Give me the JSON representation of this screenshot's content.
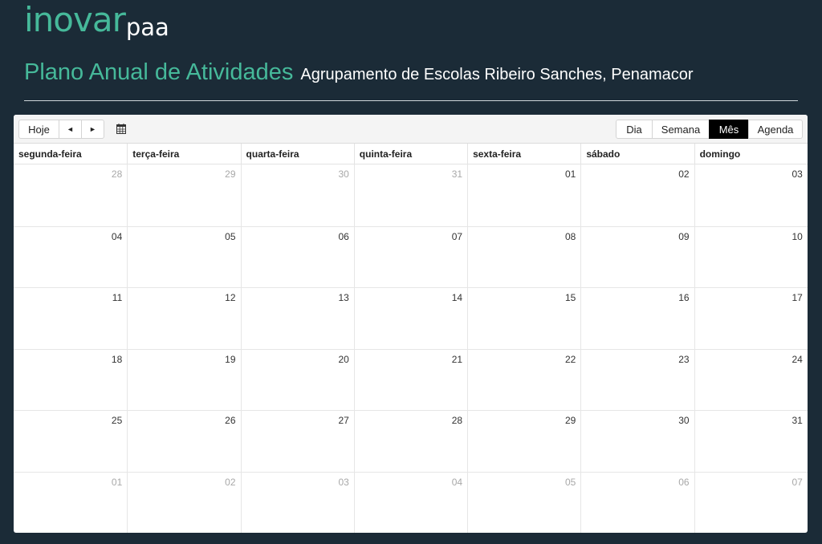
{
  "logo": {
    "main": "inovar",
    "sub": "paa"
  },
  "header": {
    "title": "Plano Anual de Atividades",
    "subtitle": "Agrupamento de Escolas Ribeiro Sanches, Penamacor"
  },
  "toolbar": {
    "today_label": "Hoje",
    "prev_label": "◄",
    "next_label": "►",
    "calendar_icon": "calendar-icon",
    "views": [
      {
        "label": "Dia",
        "active": false
      },
      {
        "label": "Semana",
        "active": false
      },
      {
        "label": "Mês",
        "active": true
      },
      {
        "label": "Agenda",
        "active": false
      }
    ]
  },
  "calendar": {
    "weekdays": [
      "segunda-feira",
      "terça-feira",
      "quarta-feira",
      "quinta-feira",
      "sexta-feira",
      "sábado",
      "domingo"
    ],
    "weeks": [
      [
        {
          "day": "28",
          "other": true
        },
        {
          "day": "29",
          "other": true
        },
        {
          "day": "30",
          "other": true
        },
        {
          "day": "31",
          "other": true
        },
        {
          "day": "01",
          "other": false
        },
        {
          "day": "02",
          "other": false
        },
        {
          "day": "03",
          "other": false
        }
      ],
      [
        {
          "day": "04",
          "other": false
        },
        {
          "day": "05",
          "other": false
        },
        {
          "day": "06",
          "other": false
        },
        {
          "day": "07",
          "other": false
        },
        {
          "day": "08",
          "other": false
        },
        {
          "day": "09",
          "other": false
        },
        {
          "day": "10",
          "other": false
        }
      ],
      [
        {
          "day": "11",
          "other": false
        },
        {
          "day": "12",
          "other": false
        },
        {
          "day": "13",
          "other": false
        },
        {
          "day": "14",
          "other": false
        },
        {
          "day": "15",
          "other": false
        },
        {
          "day": "16",
          "other": false
        },
        {
          "day": "17",
          "other": false
        }
      ],
      [
        {
          "day": "18",
          "other": false
        },
        {
          "day": "19",
          "other": false
        },
        {
          "day": "20",
          "other": false
        },
        {
          "day": "21",
          "other": false
        },
        {
          "day": "22",
          "other": false
        },
        {
          "day": "23",
          "other": false
        },
        {
          "day": "24",
          "other": false
        }
      ],
      [
        {
          "day": "25",
          "other": false
        },
        {
          "day": "26",
          "other": false
        },
        {
          "day": "27",
          "other": false
        },
        {
          "day": "28",
          "other": false
        },
        {
          "day": "29",
          "other": false
        },
        {
          "day": "30",
          "other": false
        },
        {
          "day": "31",
          "other": false
        }
      ],
      [
        {
          "day": "01",
          "other": true
        },
        {
          "day": "02",
          "other": true
        },
        {
          "day": "03",
          "other": true
        },
        {
          "day": "04",
          "other": true
        },
        {
          "day": "05",
          "other": true
        },
        {
          "day": "06",
          "other": true
        },
        {
          "day": "07",
          "other": true
        }
      ]
    ]
  },
  "colors": {
    "background": "#1b2b37",
    "accent": "#46b99a",
    "active_view": "#000000"
  }
}
